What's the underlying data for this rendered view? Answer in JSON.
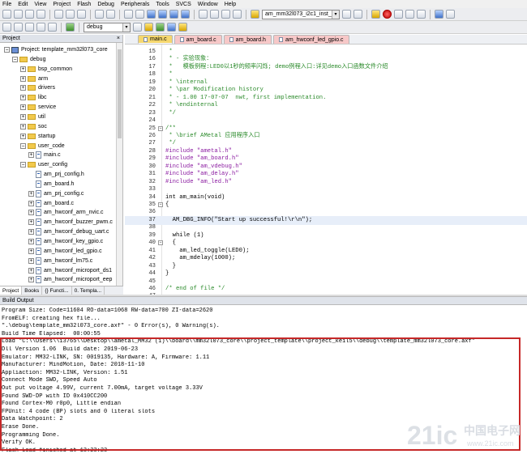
{
  "menu": [
    "File",
    "Edit",
    "View",
    "Project",
    "Flash",
    "Debug",
    "Peripherals",
    "Tools",
    "SVCS",
    "Window",
    "Help"
  ],
  "toolbar": {
    "build_target_combo": "am_mm32l073_i2c1_inst_",
    "target_select": "debug"
  },
  "project_panel": {
    "title": "Project",
    "close_glyph": "×",
    "tree": [
      {
        "label": "Project: template_mm32l073_core",
        "indent": 0,
        "kind": "project",
        "pm": "−"
      },
      {
        "label": "debug",
        "indent": 1,
        "kind": "folder",
        "pm": "−"
      },
      {
        "label": "bsp_common",
        "indent": 2,
        "kind": "folder",
        "pm": "+"
      },
      {
        "label": "arm",
        "indent": 2,
        "kind": "folder",
        "pm": "+"
      },
      {
        "label": "drivers",
        "indent": 2,
        "kind": "folder",
        "pm": "+"
      },
      {
        "label": "libc",
        "indent": 2,
        "kind": "folder",
        "pm": "+"
      },
      {
        "label": "service",
        "indent": 2,
        "kind": "folder",
        "pm": "+"
      },
      {
        "label": "util",
        "indent": 2,
        "kind": "folder",
        "pm": "+"
      },
      {
        "label": "soc",
        "indent": 2,
        "kind": "folder",
        "pm": "+"
      },
      {
        "label": "startup",
        "indent": 2,
        "kind": "folder",
        "pm": "+"
      },
      {
        "label": "user_code",
        "indent": 2,
        "kind": "folder",
        "pm": "−"
      },
      {
        "label": "main.c",
        "indent": 3,
        "kind": "file",
        "pm": "+"
      },
      {
        "label": "user_config",
        "indent": 2,
        "kind": "folder",
        "pm": "−"
      },
      {
        "label": "am_prj_config.h",
        "indent": 3,
        "kind": "file",
        "pm": ""
      },
      {
        "label": "am_board.h",
        "indent": 3,
        "kind": "file",
        "pm": ""
      },
      {
        "label": "am_prj_config.c",
        "indent": 3,
        "kind": "file",
        "pm": "+"
      },
      {
        "label": "am_board.c",
        "indent": 3,
        "kind": "file",
        "pm": "+"
      },
      {
        "label": "am_hwconf_arm_nvic.c",
        "indent": 3,
        "kind": "file",
        "pm": "+"
      },
      {
        "label": "am_hwconf_buzzer_pwm.c",
        "indent": 3,
        "kind": "file",
        "pm": "+"
      },
      {
        "label": "am_hwconf_debug_uart.c",
        "indent": 3,
        "kind": "file",
        "pm": "+"
      },
      {
        "label": "am_hwconf_key_gpio.c",
        "indent": 3,
        "kind": "file",
        "pm": "+"
      },
      {
        "label": "am_hwconf_led_gpio.c",
        "indent": 3,
        "kind": "file",
        "pm": "+"
      },
      {
        "label": "am_hwconf_lm75.c",
        "indent": 3,
        "kind": "file",
        "pm": "+"
      },
      {
        "label": "am_hwconf_microport_ds1",
        "indent": 3,
        "kind": "file",
        "pm": "+"
      },
      {
        "label": "am_hwconf_microport_eep",
        "indent": 3,
        "kind": "file",
        "pm": "+"
      }
    ],
    "tabs": [
      "Project",
      "Books",
      "{} Functi...",
      "0. Templa..."
    ]
  },
  "editor": {
    "tabs": [
      {
        "label": "main.c",
        "color": "#f5d76e"
      },
      {
        "label": "am_board.c",
        "color": "#f7c8c8"
      },
      {
        "label": "am_board.h",
        "color": "#f7c8c8"
      },
      {
        "label": "am_hwconf_led_gpio.c",
        "color": "#f7c8c8"
      }
    ],
    "lines": [
      {
        "n": "15",
        "fold": "",
        "cls": "c",
        "text": " *"
      },
      {
        "n": "16",
        "fold": "",
        "cls": "c",
        "text": " * - 实验现象："
      },
      {
        "n": "17",
        "fold": "",
        "cls": "c",
        "text": " *   模板例程:LED0以1秒的频率闪烁; demo例程入口:详见demo入口函数文件介绍"
      },
      {
        "n": "18",
        "fold": "",
        "cls": "c",
        "text": " *"
      },
      {
        "n": "19",
        "fold": "",
        "cls": "c",
        "text": " * \\internal"
      },
      {
        "n": "20",
        "fold": "",
        "cls": "c",
        "text": " * \\par Modification history"
      },
      {
        "n": "21",
        "fold": "",
        "cls": "c",
        "text": " * - 1.00 17-07-07  nwt, first implementation."
      },
      {
        "n": "22",
        "fold": "",
        "cls": "c",
        "text": " * \\endinternal"
      },
      {
        "n": "23",
        "fold": "",
        "cls": "c",
        "text": " */"
      },
      {
        "n": "24",
        "fold": "",
        "cls": "",
        "text": ""
      },
      {
        "n": "25",
        "fold": "−",
        "cls": "c",
        "text": "/**"
      },
      {
        "n": "26",
        "fold": "",
        "cls": "c",
        "text": " * \\brief AMetal 应用程序入口"
      },
      {
        "n": "27",
        "fold": "",
        "cls": "c",
        "text": " */"
      },
      {
        "n": "28",
        "fold": "",
        "cls": "pp",
        "text": "#include \"ametal.h\""
      },
      {
        "n": "29",
        "fold": "",
        "cls": "pp",
        "text": "#include \"am_board.h\""
      },
      {
        "n": "30",
        "fold": "",
        "cls": "pp",
        "text": "#include \"am_vdebug.h\""
      },
      {
        "n": "31",
        "fold": "",
        "cls": "pp",
        "text": "#include \"am_delay.h\""
      },
      {
        "n": "32",
        "fold": "",
        "cls": "pp",
        "text": "#include \"am_led.h\""
      },
      {
        "n": "33",
        "fold": "",
        "cls": "",
        "text": ""
      },
      {
        "n": "34",
        "fold": "",
        "cls": "",
        "text": "int am_main(void)"
      },
      {
        "n": "35",
        "fold": "−",
        "cls": "",
        "text": "{"
      },
      {
        "n": "36",
        "fold": "",
        "cls": "",
        "text": ""
      },
      {
        "n": "37",
        "fold": "",
        "cls": "hl",
        "text": "  AM_DBG_INFO(\"Start up successful!\\r\\n\");"
      },
      {
        "n": "38",
        "fold": "",
        "cls": "",
        "text": ""
      },
      {
        "n": "39",
        "fold": "",
        "cls": "",
        "text": "  while (1)"
      },
      {
        "n": "40",
        "fold": "−",
        "cls": "",
        "text": "  {"
      },
      {
        "n": "41",
        "fold": "",
        "cls": "",
        "text": "    am_led_toggle(LED0);"
      },
      {
        "n": "42",
        "fold": "",
        "cls": "",
        "text": "    am_mdelay(1000);"
      },
      {
        "n": "43",
        "fold": "",
        "cls": "",
        "text": "  }"
      },
      {
        "n": "44",
        "fold": "",
        "cls": "",
        "text": "}"
      },
      {
        "n": "45",
        "fold": "",
        "cls": "",
        "text": ""
      },
      {
        "n": "46",
        "fold": "",
        "cls": "c",
        "text": "/* end of file */"
      },
      {
        "n": "47",
        "fold": "",
        "cls": "",
        "text": ""
      }
    ]
  },
  "build_output": {
    "title": "Build Output",
    "lines": [
      "Program Size: Code=11604 RO-data=1068 RW-data=700 ZI-data=2620",
      "FromELF: creating hex file...",
      "\".\\debug\\template_mm32l073_core.axf\" - 0 Error(s), 0 Warning(s).",
      "Build Time Elapsed:  00:00:55",
      "Load \"C:\\\\Users\\\\13765\\\\Desktop\\\\ametal_MM32 (1)\\\\board\\\\mm32l073_core\\\\project_template\\\\project_keil5\\\\debug\\\\template_mm32l073_core.axf\"",
      "Dll Version 1.06  Build date: 2019-06-23",
      "Emulator: MM32-LINK, SN: 0019135, Hardware: A, Firmware: 1.11",
      "Manufacturer: MindMotion, Date: 2018-11-10",
      "Appliaction: MM32-LINK, Version: 1.51",
      "Connect Mode SWD, Speed Auto",
      "Out put voltage 4.99V, current 7.00mA, target voltage 3.33V",
      "Found SWD-DP with ID 0x410CC200",
      "Found Cortex-M0 r0p0, Little endian",
      "FPUnit: 4 code (BP) slots and 0 literal slots",
      "Data Watchpoint: 2",
      "Erase Done.",
      "Programming Done.",
      "Verify OK.",
      "Flash Load finished at 13:23:23"
    ],
    "highlight_color": "#c62828"
  },
  "watermark": {
    "text_main": "21ic",
    "text_cn": "中国电子网",
    "text_url": "www.21ic.com"
  }
}
